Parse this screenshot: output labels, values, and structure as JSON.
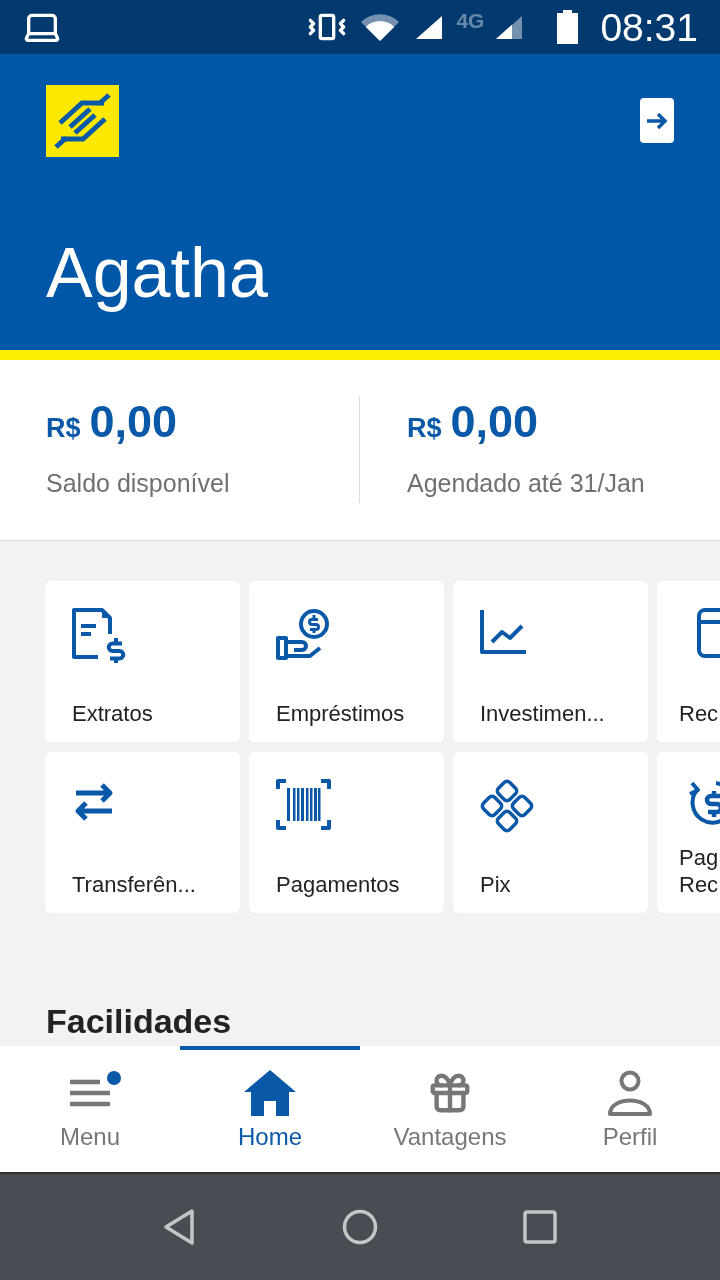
{
  "status_bar": {
    "network": "4G",
    "time": "08:31"
  },
  "header": {
    "user_name": "Agatha"
  },
  "balances": [
    {
      "currency": "R$",
      "amount": "0,00",
      "label": "Saldo disponível"
    },
    {
      "currency": "R$",
      "amount": "0,00",
      "label": "Agendado até 31/Jan"
    }
  ],
  "shortcut_rows": [
    {
      "items": [
        {
          "label": "Extratos"
        },
        {
          "label": "Empréstimos"
        },
        {
          "label": "Investimen..."
        },
        {
          "label": "Rec"
        }
      ]
    },
    {
      "items": [
        {
          "label": "Transferên..."
        },
        {
          "label": "Pagamentos"
        },
        {
          "label": "Pix"
        },
        {
          "label": "Pag Rec"
        }
      ]
    }
  ],
  "section_heading": "Facilidades",
  "bottom_nav": [
    {
      "label": "Menu",
      "selected": false,
      "notification": true
    },
    {
      "label": "Home",
      "selected": true,
      "notification": false
    },
    {
      "label": "Vantagens",
      "selected": false,
      "notification": false
    },
    {
      "label": "Perfil",
      "selected": false,
      "notification": false
    }
  ]
}
